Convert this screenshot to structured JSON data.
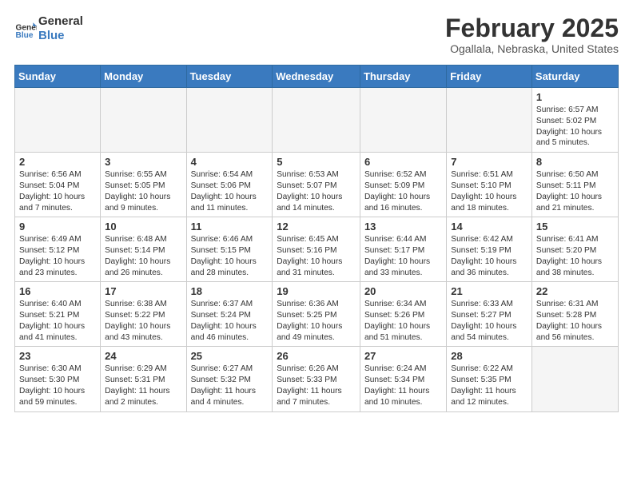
{
  "header": {
    "logo_line1": "General",
    "logo_line2": "Blue",
    "month": "February 2025",
    "location": "Ogallala, Nebraska, United States"
  },
  "weekdays": [
    "Sunday",
    "Monday",
    "Tuesday",
    "Wednesday",
    "Thursday",
    "Friday",
    "Saturday"
  ],
  "weeks": [
    [
      {
        "day": "",
        "info": ""
      },
      {
        "day": "",
        "info": ""
      },
      {
        "day": "",
        "info": ""
      },
      {
        "day": "",
        "info": ""
      },
      {
        "day": "",
        "info": ""
      },
      {
        "day": "",
        "info": ""
      },
      {
        "day": "1",
        "info": "Sunrise: 6:57 AM\nSunset: 5:02 PM\nDaylight: 10 hours\nand 5 minutes."
      }
    ],
    [
      {
        "day": "2",
        "info": "Sunrise: 6:56 AM\nSunset: 5:04 PM\nDaylight: 10 hours\nand 7 minutes."
      },
      {
        "day": "3",
        "info": "Sunrise: 6:55 AM\nSunset: 5:05 PM\nDaylight: 10 hours\nand 9 minutes."
      },
      {
        "day": "4",
        "info": "Sunrise: 6:54 AM\nSunset: 5:06 PM\nDaylight: 10 hours\nand 11 minutes."
      },
      {
        "day": "5",
        "info": "Sunrise: 6:53 AM\nSunset: 5:07 PM\nDaylight: 10 hours\nand 14 minutes."
      },
      {
        "day": "6",
        "info": "Sunrise: 6:52 AM\nSunset: 5:09 PM\nDaylight: 10 hours\nand 16 minutes."
      },
      {
        "day": "7",
        "info": "Sunrise: 6:51 AM\nSunset: 5:10 PM\nDaylight: 10 hours\nand 18 minutes."
      },
      {
        "day": "8",
        "info": "Sunrise: 6:50 AM\nSunset: 5:11 PM\nDaylight: 10 hours\nand 21 minutes."
      }
    ],
    [
      {
        "day": "9",
        "info": "Sunrise: 6:49 AM\nSunset: 5:12 PM\nDaylight: 10 hours\nand 23 minutes."
      },
      {
        "day": "10",
        "info": "Sunrise: 6:48 AM\nSunset: 5:14 PM\nDaylight: 10 hours\nand 26 minutes."
      },
      {
        "day": "11",
        "info": "Sunrise: 6:46 AM\nSunset: 5:15 PM\nDaylight: 10 hours\nand 28 minutes."
      },
      {
        "day": "12",
        "info": "Sunrise: 6:45 AM\nSunset: 5:16 PM\nDaylight: 10 hours\nand 31 minutes."
      },
      {
        "day": "13",
        "info": "Sunrise: 6:44 AM\nSunset: 5:17 PM\nDaylight: 10 hours\nand 33 minutes."
      },
      {
        "day": "14",
        "info": "Sunrise: 6:42 AM\nSunset: 5:19 PM\nDaylight: 10 hours\nand 36 minutes."
      },
      {
        "day": "15",
        "info": "Sunrise: 6:41 AM\nSunset: 5:20 PM\nDaylight: 10 hours\nand 38 minutes."
      }
    ],
    [
      {
        "day": "16",
        "info": "Sunrise: 6:40 AM\nSunset: 5:21 PM\nDaylight: 10 hours\nand 41 minutes."
      },
      {
        "day": "17",
        "info": "Sunrise: 6:38 AM\nSunset: 5:22 PM\nDaylight: 10 hours\nand 43 minutes."
      },
      {
        "day": "18",
        "info": "Sunrise: 6:37 AM\nSunset: 5:24 PM\nDaylight: 10 hours\nand 46 minutes."
      },
      {
        "day": "19",
        "info": "Sunrise: 6:36 AM\nSunset: 5:25 PM\nDaylight: 10 hours\nand 49 minutes."
      },
      {
        "day": "20",
        "info": "Sunrise: 6:34 AM\nSunset: 5:26 PM\nDaylight: 10 hours\nand 51 minutes."
      },
      {
        "day": "21",
        "info": "Sunrise: 6:33 AM\nSunset: 5:27 PM\nDaylight: 10 hours\nand 54 minutes."
      },
      {
        "day": "22",
        "info": "Sunrise: 6:31 AM\nSunset: 5:28 PM\nDaylight: 10 hours\nand 56 minutes."
      }
    ],
    [
      {
        "day": "23",
        "info": "Sunrise: 6:30 AM\nSunset: 5:30 PM\nDaylight: 10 hours\nand 59 minutes."
      },
      {
        "day": "24",
        "info": "Sunrise: 6:29 AM\nSunset: 5:31 PM\nDaylight: 11 hours\nand 2 minutes."
      },
      {
        "day": "25",
        "info": "Sunrise: 6:27 AM\nSunset: 5:32 PM\nDaylight: 11 hours\nand 4 minutes."
      },
      {
        "day": "26",
        "info": "Sunrise: 6:26 AM\nSunset: 5:33 PM\nDaylight: 11 hours\nand 7 minutes."
      },
      {
        "day": "27",
        "info": "Sunrise: 6:24 AM\nSunset: 5:34 PM\nDaylight: 11 hours\nand 10 minutes."
      },
      {
        "day": "28",
        "info": "Sunrise: 6:22 AM\nSunset: 5:35 PM\nDaylight: 11 hours\nand 12 minutes."
      },
      {
        "day": "",
        "info": ""
      }
    ]
  ]
}
